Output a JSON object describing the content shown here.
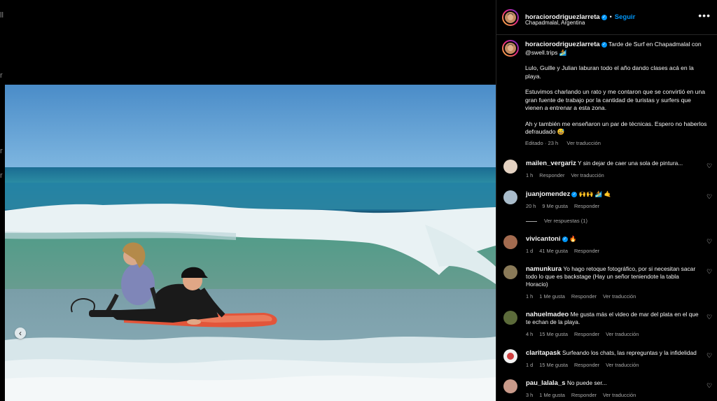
{
  "background": {
    "side_glyphs": [
      "ll",
      "r",
      "r",
      "r"
    ]
  },
  "media": {
    "prev_icon": "chevron-left"
  },
  "post": {
    "username": "horaciorodriguezlarreta",
    "follow_label": "Seguir",
    "location": "Chapadmalal, Argentina",
    "more_label": "•••",
    "caption_username": "horaciorodriguezlarreta",
    "caption_first": "Tarde de Surf en Chapadmalal con @swell.trips 🏄",
    "caption_paragraphs": [
      "Lulo, Guille y Julian laburan todo el año dando clases acá en la playa.",
      "Estuvimos charlando un rato y me contaron que se convirtió en una gran fuente de trabajo por la cantidad de turistas y surfers que vienen a entrenar a esta zona.",
      "Ah y también me enseñaron un par de técnicas. Espero no haberlos defraudado 😅"
    ],
    "edited": "Editado · 23 h",
    "translate": "Ver traducción"
  },
  "comments": [
    {
      "user": "mailen_vergariz",
      "text": "Y sin dejar de caer una sola de pintura...",
      "time": "1 h",
      "likes": "",
      "reply": "Responder",
      "translate": "Ver traducción",
      "verified": false,
      "avatar_color": "#d9c7b8"
    },
    {
      "user": "juanjomendez",
      "text": "🙌🙌 🏄 🤙",
      "time": "20 h",
      "likes": "9 Me gusta",
      "reply": "Responder",
      "translate": "",
      "verified": true,
      "avatar_color": "#9fb3c0"
    },
    {
      "user": "vivicantoni",
      "text": "🔥",
      "time": "1 d",
      "likes": "41 Me gusta",
      "reply": "Responder",
      "translate": "",
      "verified": true,
      "avatar_color": "#a36b4f"
    },
    {
      "user": "namunkura",
      "text": "Yo hago retoque fotográfico, por si necesitan sacar todo lo que es backstage (Hay un señor teniendote la tabla Horacio)",
      "time": "1 h",
      "likes": "1 Me gusta",
      "reply": "Responder",
      "translate": "Ver traducción",
      "verified": false,
      "avatar_color": "#7a6a50"
    },
    {
      "user": "nahuelmadeo",
      "text": "Me gusta más el video de mar del plata en el que te echan de la playa.",
      "time": "4 h",
      "likes": "15 Me gusta",
      "reply": "Responder",
      "translate": "Ver traducción",
      "verified": false,
      "avatar_color": "#5c6b3a"
    },
    {
      "user": "claritapask",
      "text": "Surfeando los chats, las repreguntas y la infidelidad",
      "time": "1 d",
      "likes": "15 Me gusta",
      "reply": "Responder",
      "translate": "Ver traducción",
      "verified": false,
      "avatar_color": "#d04040"
    },
    {
      "user": "pau_lalala_s",
      "text": "No puede ser...",
      "time": "3 h",
      "likes": "1 Me gusta",
      "reply": "Responder",
      "translate": "Ver traducción",
      "verified": false,
      "avatar_color": "#c99a8a"
    }
  ],
  "view_replies": "Ver respuestas (1)",
  "colors": {
    "accent": "#0095f6",
    "muted": "#a8a8a8",
    "text": "#f5f5f5",
    "background": "#000000"
  }
}
